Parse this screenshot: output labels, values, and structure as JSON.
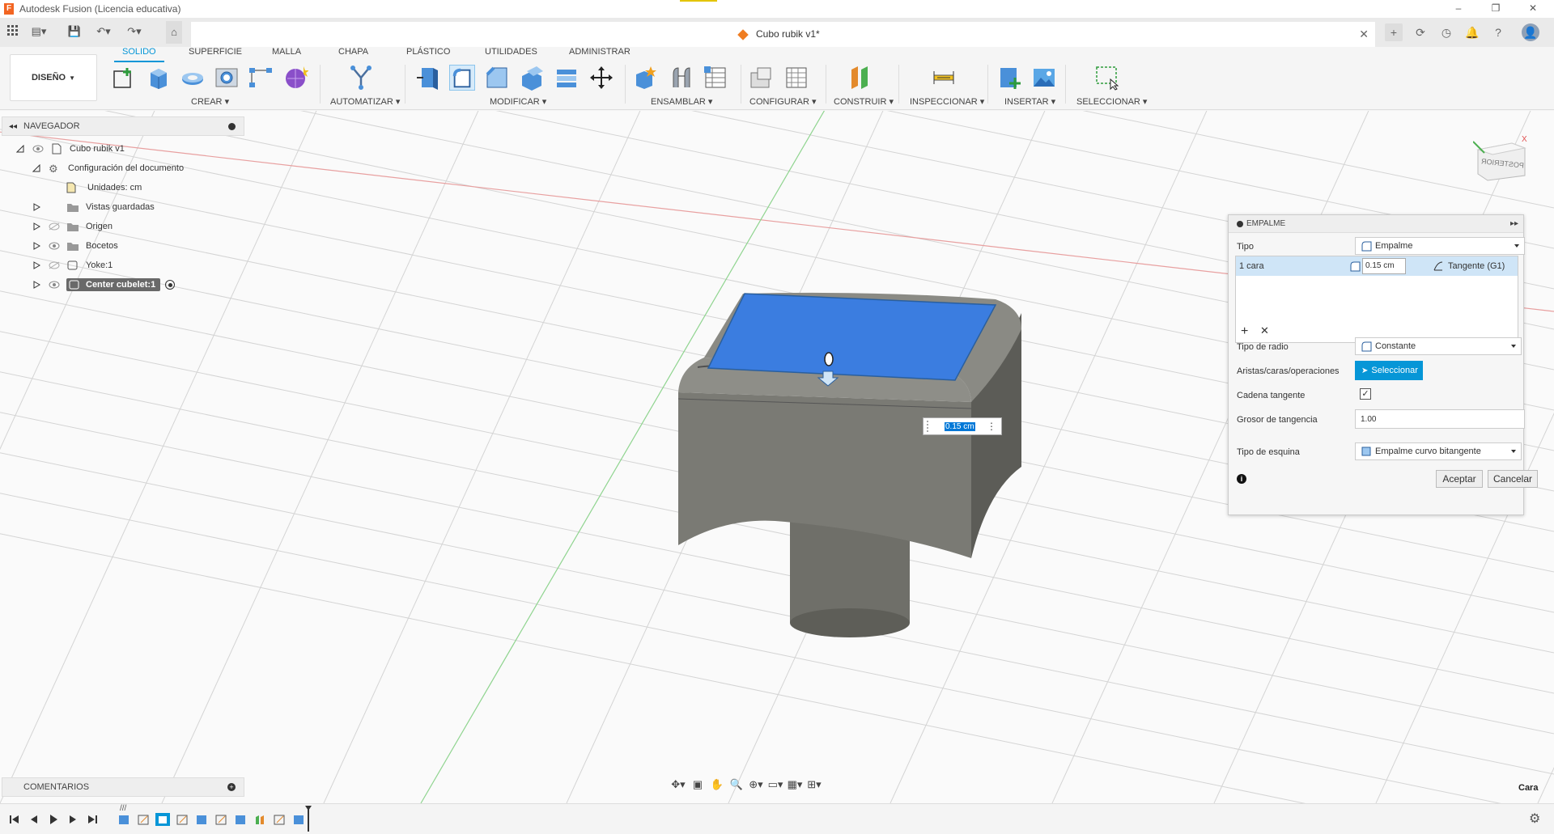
{
  "window": {
    "title": "Autodesk Fusion (Licencia educativa)",
    "doc_title": "Cubo rubik v1*"
  },
  "ribbon": {
    "workspace": "DISEÑO",
    "tabs": [
      "SOLIDO",
      "SUPERFICIE",
      "MALLA",
      "CHAPA",
      "PLÁSTICO",
      "UTILIDADES",
      "ADMINISTRAR"
    ],
    "active_tab": "SOLIDO",
    "groups": [
      "CREAR",
      "AUTOMATIZAR",
      "MODIFICAR",
      "ENSAMBLAR",
      "CONFIGURAR",
      "CONSTRUIR",
      "INSPECCIONAR",
      "INSERTAR",
      "SELECCIONAR"
    ]
  },
  "navigator": {
    "title": "NAVEGADOR",
    "items": [
      {
        "label": "Cubo rubik v1"
      },
      {
        "label": "Configuración del documento"
      },
      {
        "label": "Unidades: cm"
      },
      {
        "label": "Vistas guardadas"
      },
      {
        "label": "Origen"
      },
      {
        "label": "Bocetos"
      },
      {
        "label": "Yoke:1"
      },
      {
        "label": "Center cubelet:1"
      }
    ]
  },
  "comments": {
    "title": "COMENTARIOS"
  },
  "viewport": {
    "dimension_value": "0.15 cm",
    "viewcube_label": "POSTERIOR",
    "selection_status": "Cara"
  },
  "dialog": {
    "title": "EMPALME",
    "tipo_label": "Tipo",
    "tipo_value": "Empalme",
    "row_selection": "1 cara",
    "row_radius": "0.15 cm",
    "row_continuity": "Tangente (G1)",
    "radius_type_label": "Tipo de radio",
    "radius_type_value": "Constante",
    "edges_label": "Aristas/caras/operaciones",
    "select_button": "Seleccionar",
    "tangent_chain_label": "Cadena tangente",
    "tangent_chain_checked": true,
    "tangency_weight_label": "Grosor de tangencia",
    "tangency_weight_value": "1.00",
    "corner_type_label": "Tipo de esquina",
    "corner_type_value": "Empalme curvo bitangente",
    "ok_button": "Aceptar",
    "cancel_button": "Cancelar"
  },
  "colors": {
    "accent": "#0696d7",
    "selected_face": "#3b7de0",
    "body": "#7a7a74"
  }
}
